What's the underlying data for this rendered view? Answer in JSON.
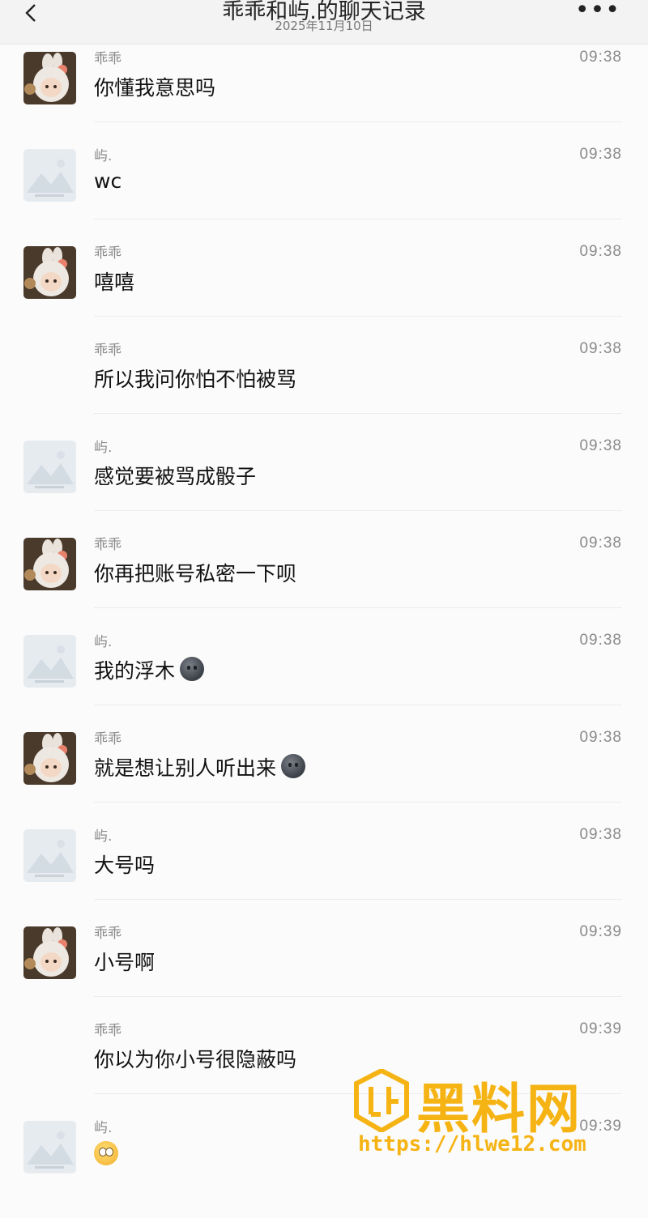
{
  "header": {
    "title": "乖乖和屿.的聊天记录",
    "date": "2025年11月10日"
  },
  "messages": [
    {
      "sender": "乖乖",
      "time": "09:38",
      "text": "你懂我意思吗",
      "avatar": "bunny"
    },
    {
      "sender": "屿.",
      "time": "09:38",
      "text": "wc",
      "avatar": "placeholder"
    },
    {
      "sender": "乖乖",
      "time": "09:38",
      "text": "嘻嘻",
      "avatar": "bunny"
    },
    {
      "sender": "乖乖",
      "time": "09:38",
      "text": "所以我问你怕不怕被骂",
      "avatar": "none"
    },
    {
      "sender": "屿.",
      "time": "09:38",
      "text": "感觉要被骂成骰子",
      "avatar": "placeholder"
    },
    {
      "sender": "乖乖",
      "time": "09:38",
      "text": "你再把账号私密一下呗",
      "avatar": "bunny"
    },
    {
      "sender": "屿.",
      "time": "09:38",
      "text": "我的浮木",
      "emoji": "dark-face",
      "avatar": "placeholder"
    },
    {
      "sender": "乖乖",
      "time": "09:38",
      "text": "就是想让别人听出来",
      "emoji": "dark-face",
      "avatar": "bunny"
    },
    {
      "sender": "屿.",
      "time": "09:38",
      "text": "大号吗",
      "avatar": "placeholder"
    },
    {
      "sender": "乖乖",
      "time": "09:39",
      "text": "小号啊",
      "avatar": "bunny"
    },
    {
      "sender": "乖乖",
      "time": "09:39",
      "text": "你以为你小号很隐蔽吗",
      "avatar": "none"
    },
    {
      "sender": "屿.",
      "time": "09:39",
      "text": "",
      "emoji": "flushed-face",
      "avatar": "placeholder"
    }
  ],
  "watermark": {
    "brand": "黑料网",
    "url": "https://hlwe12.com"
  },
  "colors": {
    "accent_watermark": "#f5b314",
    "meta_text": "#8a8a8a"
  }
}
